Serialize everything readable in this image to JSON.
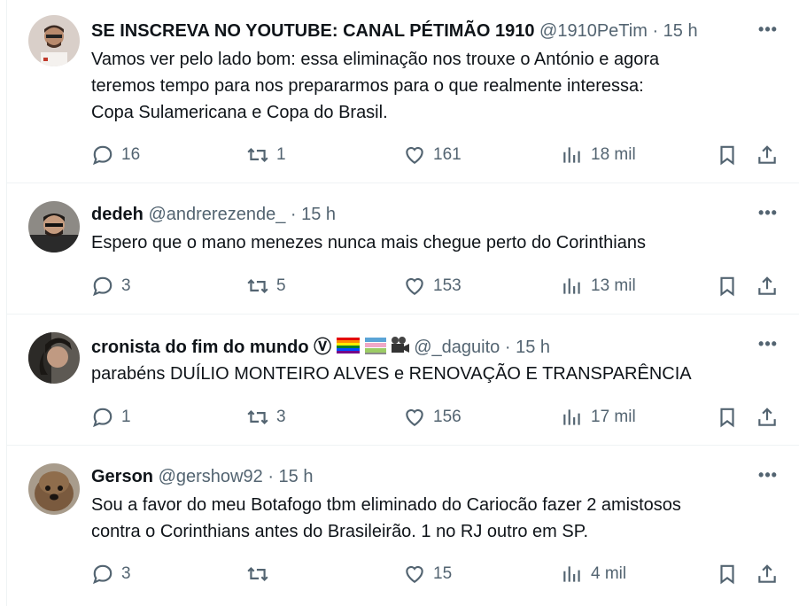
{
  "tweets": [
    {
      "name": "SE INSCREVA NO YOUTUBE: CANAL PÉTIMÃO 1910",
      "handle": "@1910PeTim",
      "time": "15 h",
      "text": "Vamos ver pelo lado bom: essa eliminação nos trouxe o António e agora\nteremos tempo para nos prepararmos para o que realmente interessa:\nCopa Sulamericana e Copa do Brasil.",
      "replies": "16",
      "retweets": "1",
      "likes": "161",
      "views": "18 mil"
    },
    {
      "name": "dedeh",
      "handle": "@andrerezende_",
      "time": "15 h",
      "text": "Espero que o mano menezes nunca mais chegue perto do Corinthians",
      "replies": "3",
      "retweets": "5",
      "likes": "153",
      "views": "13 mil"
    },
    {
      "name": "cronista do fim do mundo Ⓥ",
      "handle": "@_daguito",
      "time": "15 h",
      "text": "parabéns DUÍLIO MONTEIRO ALVES e RENOVAÇÃO E TRANSPARÊNCIA",
      "replies": "1",
      "retweets": "3",
      "likes": "156",
      "views": "17 mil"
    },
    {
      "name": "Gerson",
      "handle": "@gershow92",
      "time": "15 h",
      "text": "Sou a favor do meu Botafogo tbm eliminado do Cariocão fazer 2 amistosos\ncontra o Corinthians antes do Brasileirão. 1 no RJ outro em SP.",
      "replies": "3",
      "retweets": "",
      "likes": "15",
      "views": "4 mil"
    }
  ],
  "ui": {
    "separator": "·",
    "more": "•••"
  },
  "icons": [
    "reply-icon",
    "retweet-icon",
    "like-icon",
    "views-icon",
    "bookmark-icon",
    "share-icon",
    "more-icon"
  ],
  "colors": {
    "text": "#0f1419",
    "secondary": "#536471",
    "divider": "#eff3f4"
  }
}
